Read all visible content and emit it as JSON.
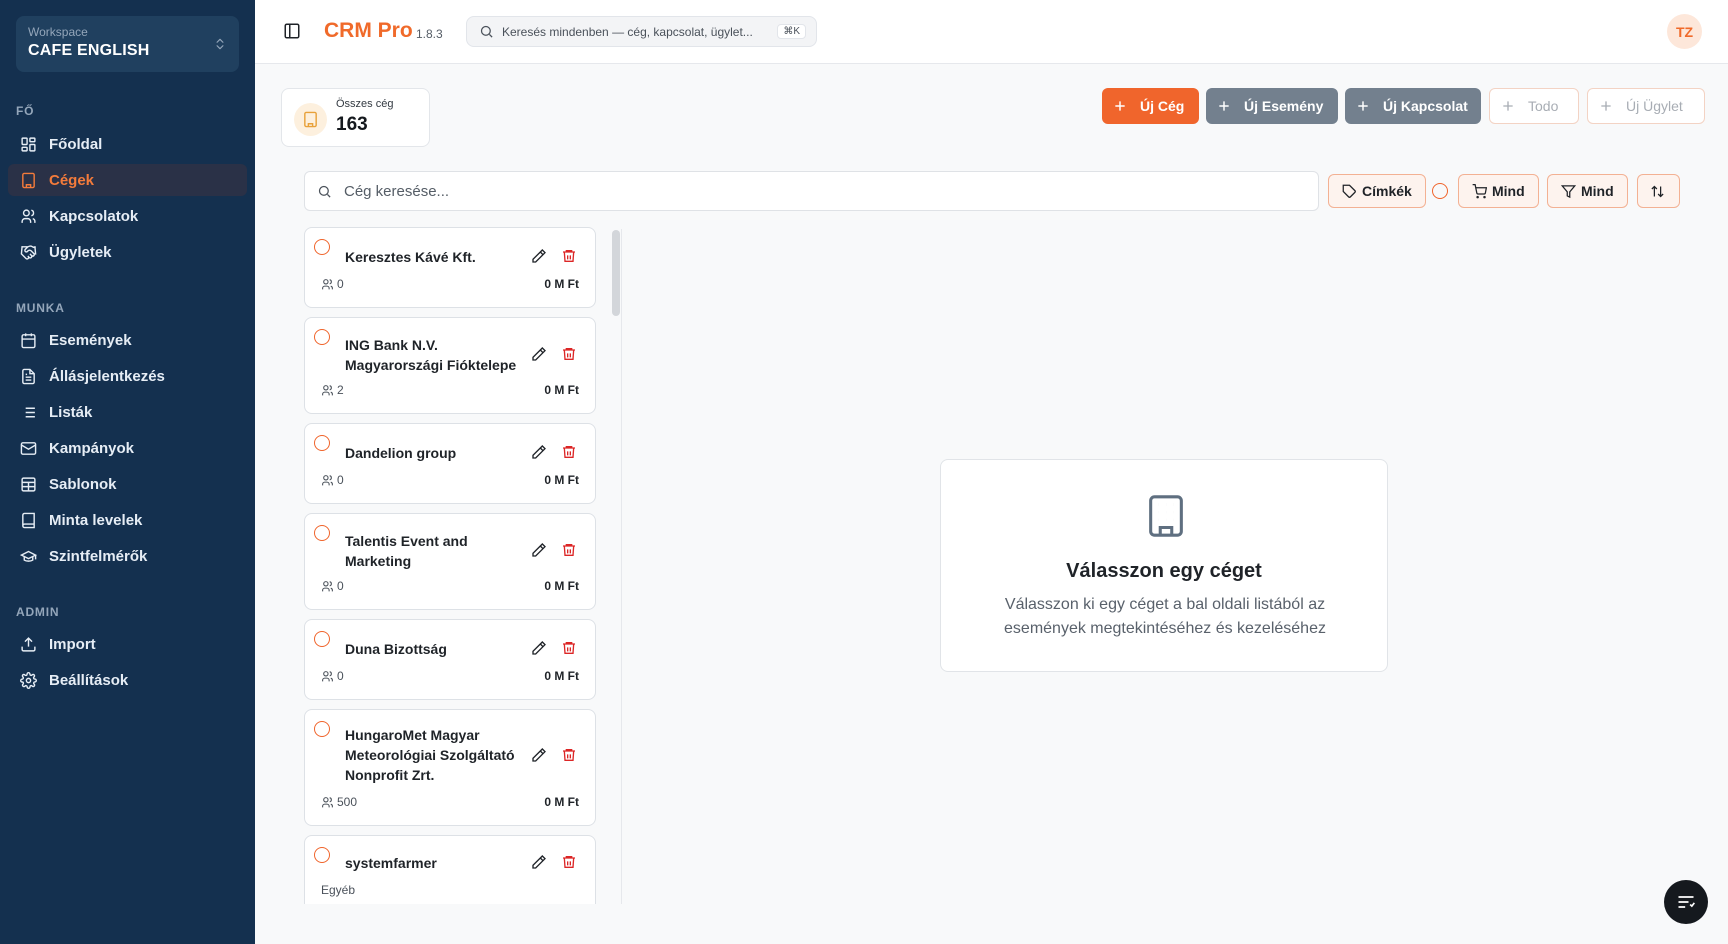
{
  "sidebar": {
    "workspace_label": "Workspace",
    "workspace_name": "CAFE ENGLISH",
    "sections": [
      {
        "title": "FŐ",
        "items": [
          {
            "label": "Főoldal",
            "icon": "dashboard-icon"
          },
          {
            "label": "Cégek",
            "icon": "building-icon",
            "active": true
          },
          {
            "label": "Kapcsolatok",
            "icon": "users-icon"
          },
          {
            "label": "Ügyletek",
            "icon": "handshake-icon"
          }
        ]
      },
      {
        "title": "MUNKA",
        "items": [
          {
            "label": "Események",
            "icon": "calendar-icon"
          },
          {
            "label": "Állásjelentkezés",
            "icon": "file-icon"
          },
          {
            "label": "Listák",
            "icon": "list-icon"
          },
          {
            "label": "Kampányok",
            "icon": "mail-icon"
          },
          {
            "label": "Sablonok",
            "icon": "table-icon"
          },
          {
            "label": "Minta levelek",
            "icon": "book-icon"
          },
          {
            "label": "Szintfelmérők",
            "icon": "graduation-cap-icon"
          }
        ]
      },
      {
        "title": "ADMIN",
        "items": [
          {
            "label": "Import",
            "icon": "upload-icon"
          },
          {
            "label": "Beállítások",
            "icon": "gear-icon"
          }
        ]
      }
    ]
  },
  "header": {
    "brand": "CRM Pro",
    "version": "1.8.3",
    "search_placeholder": "Keresés mindenben — cég, kapcsolat, ügylet...",
    "search_shortcut": "⌘K",
    "avatar_initials": "TZ"
  },
  "stats": {
    "label": "Összes cég",
    "value": "163"
  },
  "actions": [
    {
      "label": "Új Cég",
      "style": "primary"
    },
    {
      "label": "Új Esemény",
      "style": "gray"
    },
    {
      "label": "Új Kapcsolat",
      "style": "gray"
    },
    {
      "label": "Todo",
      "style": "disabled"
    },
    {
      "label": "Új Ügylet",
      "style": "disabled"
    }
  ],
  "filters": {
    "search_placeholder": "Cég keresése...",
    "tags_label": "Címkék",
    "cart_label": "Mind",
    "filter_label": "Mind"
  },
  "companies": [
    {
      "name": "Keresztes Kávé Kft.",
      "contacts": "0",
      "amount": "0 M Ft"
    },
    {
      "name": "ING Bank N.V. Magyarországi Fióktelepe",
      "contacts": "2",
      "amount": "0 M Ft"
    },
    {
      "name": "Dandelion group",
      "contacts": "0",
      "amount": "0 M Ft"
    },
    {
      "name": "Talentis Event and Marketing",
      "contacts": "0",
      "amount": "0 M Ft"
    },
    {
      "name": "Duna Bizottság",
      "contacts": "0",
      "amount": "0 M Ft"
    },
    {
      "name": "HungaroMet Magyar Meteorológiai Szolgáltató Nonprofit Zrt.",
      "contacts": "500",
      "amount": "0 M Ft"
    },
    {
      "name": "systemfarmer",
      "category": "Egyéb"
    }
  ],
  "empty_state": {
    "title": "Válasszon egy céget",
    "subtitle": "Válasszon ki egy céget a bal oldali listából az események megtekintéséhez és kezeléséhez"
  },
  "colors": {
    "accent": "#f0652c",
    "sidebar_bg": "#14304f",
    "danger": "#dc2626"
  }
}
